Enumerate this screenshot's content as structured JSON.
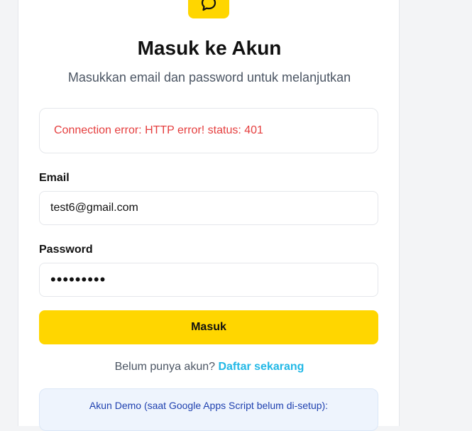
{
  "header": {
    "title": "Masuk ke Akun",
    "subtitle": "Masukkan email dan password untuk melanjutkan"
  },
  "logo": {
    "icon": "chat-bubble-icon",
    "color": "#ffd600"
  },
  "error": {
    "message": "Connection error: HTTP error! status: 401",
    "color": "#e53e3e"
  },
  "form": {
    "email_label": "Email",
    "email_value": "test6@gmail.com",
    "password_label": "Password",
    "password_value": "•••••••••",
    "submit_label": "Masuk"
  },
  "signup": {
    "prompt": "Belum punya akun?",
    "link": "Daftar sekarang"
  },
  "demo": {
    "title": "Akun Demo (saat Google Apps Script belum di-setup):"
  },
  "colors": {
    "accent": "#ffd600",
    "link": "#22b8e6"
  }
}
